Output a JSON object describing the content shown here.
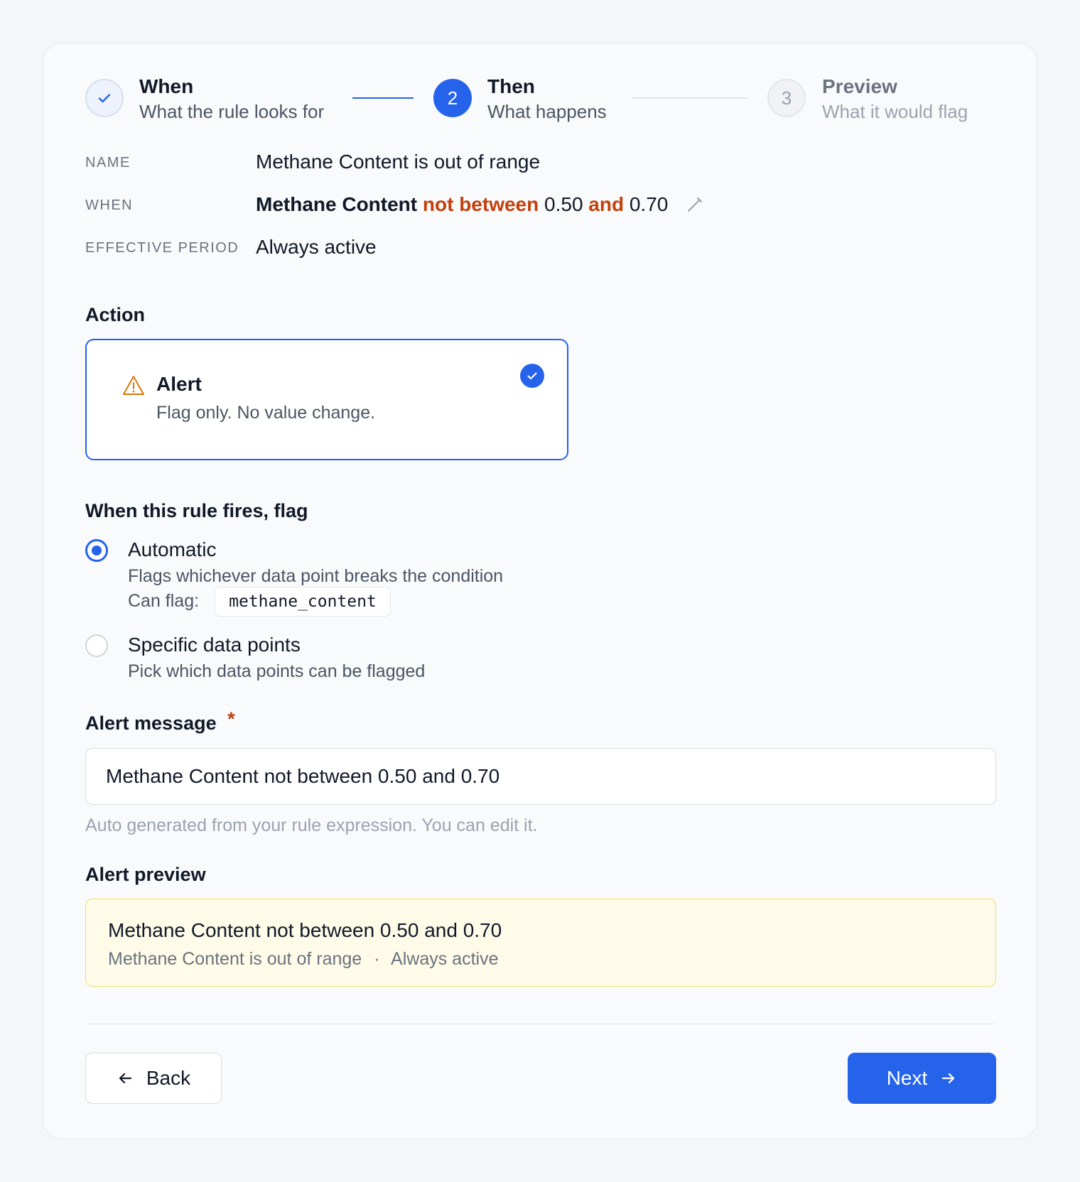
{
  "stepper": {
    "steps": [
      {
        "number": "1",
        "title": "When",
        "subtitle": "What the rule looks for",
        "state": "done"
      },
      {
        "number": "2",
        "title": "Then",
        "subtitle": "What happens",
        "state": "active"
      },
      {
        "number": "3",
        "title": "Preview",
        "subtitle": "What it would flag",
        "state": "pending"
      }
    ]
  },
  "summary": {
    "name_label": "NAME",
    "name_value": "Methane Content is out of range",
    "when_label": "WHEN",
    "when_field": "Methane Content",
    "when_operator": "not between",
    "when_low": "0.50",
    "when_and": "and",
    "when_high": "0.70",
    "period_label": "EFFECTIVE PERIOD",
    "period_value": "Always active"
  },
  "action": {
    "section_title": "Action",
    "option_title": "Alert",
    "option_desc": "Flag only. No value change."
  },
  "flag": {
    "section_title": "When this rule fires, flag",
    "options": [
      {
        "label": "Automatic",
        "desc": "Flags whichever data point breaks the condition",
        "checked": true
      },
      {
        "label": "Specific data points",
        "desc": "Pick which data points can be flagged",
        "checked": false
      }
    ],
    "can_flag_label": "Can flag:",
    "can_flag_value": "methane_content"
  },
  "alert_message": {
    "label": "Alert message",
    "required_mark": "*",
    "value": "Methane Content not between 0.50 and 0.70",
    "hint": "Auto generated from your rule expression. You can edit it."
  },
  "alert_preview": {
    "label": "Alert preview",
    "title": "Methane Content not between 0.50 and 0.70",
    "meta_name": "Methane Content is out of range",
    "meta_sep": "·",
    "meta_period": "Always active"
  },
  "footer": {
    "back_label": "Back",
    "next_label": "Next"
  },
  "colors": {
    "accent": "#2563eb",
    "highlight": "#c2410c",
    "warning": "#d97706",
    "preview_bg": "#fefce8",
    "preview_border": "#f2dc72"
  }
}
